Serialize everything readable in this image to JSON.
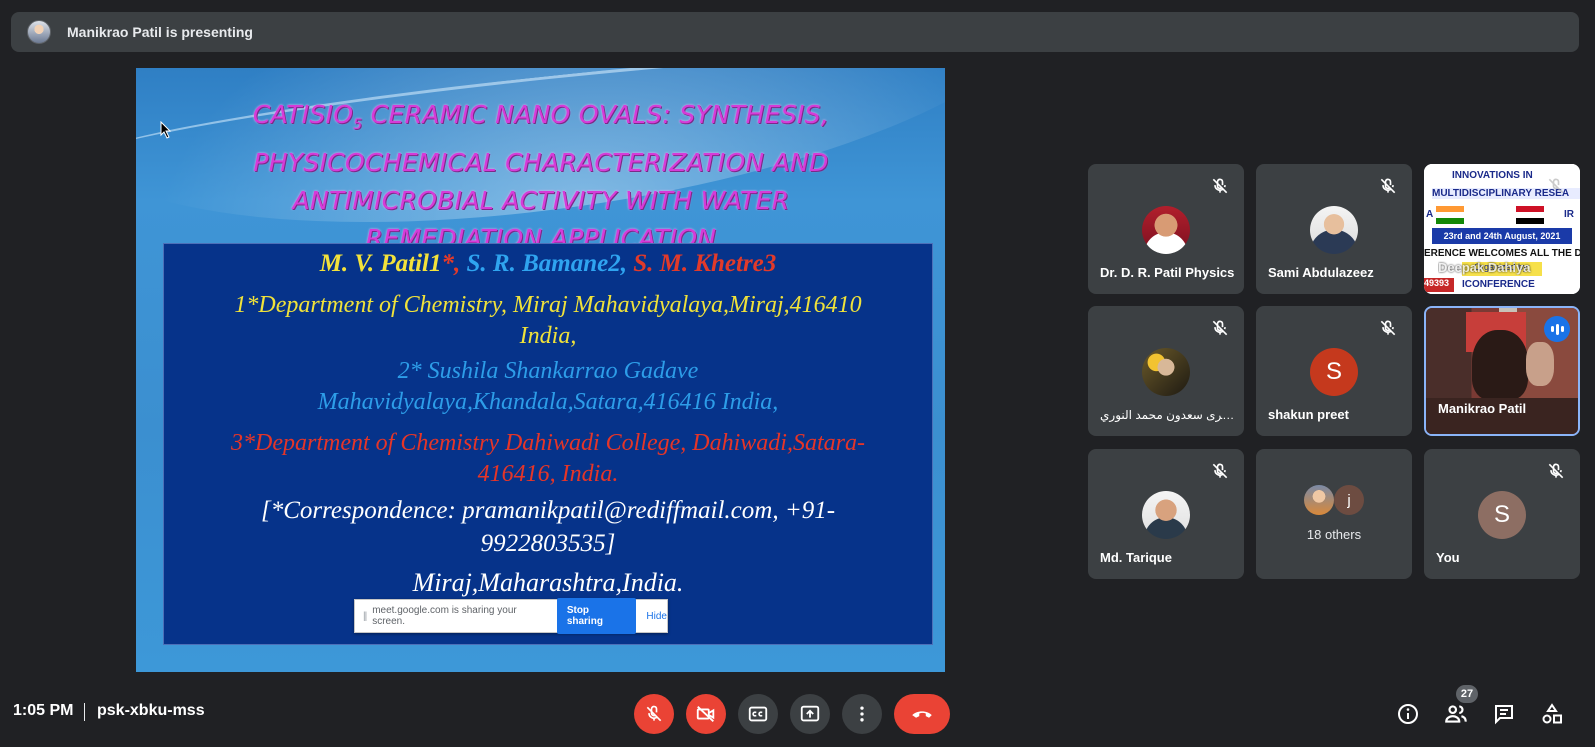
{
  "topbar": {
    "presenting_label": "Manikrao Patil is presenting"
  },
  "slide": {
    "title_line1_pre": "CaTiSiO",
    "title_sub": "5",
    "title_line1_post": " Ceramic Nano Ovals: Synthesis,",
    "title_line2": "Physicochemical Characterization and",
    "title_line3": "Antimicrobial Activity with Water",
    "title_line4": "Remediation Application",
    "author1": "M. V. Patil1",
    "author2_sep": "*, ",
    "author2": "S. R. Bamane2",
    "author3_sep": ", ",
    "author3": "S. M. Khetre3",
    "aff1_line1": "1*Department of Chemistry, Miraj Mahavidyalaya,Miraj,416410",
    "aff1_line2": "India,",
    "aff2_line1": "2* Sushila Shankarrao Gadave",
    "aff2_line2": "Mahavidyalaya,Khandala,Satara,416416  India,",
    "aff3_line1": "3*Department of Chemistry Dahiwadi College, Dahiwadi,Satara-",
    "aff3_line2": "416416, India.",
    "corr_line1": "[*Correspondence: pramanikpatil@rediffmail.com, +91-",
    "corr_line2": "9922803535]",
    "place": "Miraj,Maharashtra,India.",
    "share_bar": {
      "grip": "||",
      "message": "meet.google.com is sharing your screen.",
      "stop_label": "Stop sharing",
      "hide_label": "Hide"
    }
  },
  "participants": [
    {
      "name": "Dr. D. R. Patil Physics",
      "muted": true
    },
    {
      "name": "Sami Abdulazeez",
      "muted": true
    },
    {
      "name": "Deepak Dahiya",
      "muted": true,
      "banner": {
        "line1": "INNOVATIONS IN",
        "line2": "MULTIDISCIPLINARY RESEA",
        "flag_left": "A",
        "flag_right": "IR",
        "date": "23rd and 24th August, 2021",
        "welcome": "ERENCE WELCOMES ALL THE DELI",
        "code": "49393",
        "org": "Organized by:",
        "footer": "ICONFERENCE"
      }
    },
    {
      "name": "بشرى سعدون محمد النوري",
      "muted": true
    },
    {
      "name": "shakun preet",
      "muted": true,
      "initial": "S"
    },
    {
      "name": "Manikrao Patil",
      "muted": false,
      "speaking": true
    },
    {
      "name": "Md. Tarique",
      "muted": true
    },
    {
      "name": "18 others",
      "muted": false,
      "initial": "j"
    },
    {
      "name": "You",
      "muted": true,
      "initial": "S"
    }
  ],
  "bottombar": {
    "time": "1:05 PM",
    "meeting_code": "psk-xbku-mss",
    "participant_count": "27"
  },
  "colors": {
    "background": "#202124",
    "tile": "#3c4043",
    "danger": "#ea4335",
    "accent": "#1a73e8",
    "shakun_avatar": "#c5391d",
    "you_avatar": "#8d6e63"
  }
}
